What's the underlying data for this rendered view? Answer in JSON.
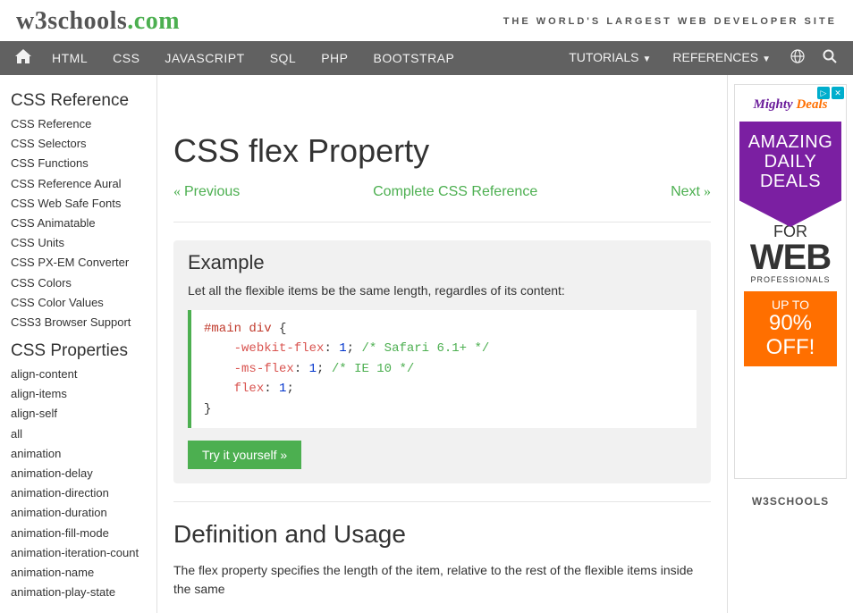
{
  "header": {
    "logo_w3": "w3schools",
    "logo_com": ".com",
    "tagline": "THE WORLD'S LARGEST WEB DEVELOPER SITE"
  },
  "topnav": {
    "items": [
      "HTML",
      "CSS",
      "JAVASCRIPT",
      "SQL",
      "PHP",
      "BOOTSTRAP"
    ],
    "dropdowns": [
      "TUTORIALS",
      "REFERENCES"
    ]
  },
  "sidebar": {
    "section1_title": "CSS Reference",
    "section1_items": [
      "CSS Reference",
      "CSS Selectors",
      "CSS Functions",
      "CSS Reference Aural",
      "CSS Web Safe Fonts",
      "CSS Animatable",
      "CSS Units",
      "CSS PX-EM Converter",
      "CSS Colors",
      "CSS Color Values",
      "CSS3 Browser Support"
    ],
    "section2_title": "CSS Properties",
    "section2_items": [
      "align-content",
      "align-items",
      "align-self",
      "all",
      "animation",
      "animation-delay",
      "animation-direction",
      "animation-duration",
      "animation-fill-mode",
      "animation-iteration-count",
      "animation-name",
      "animation-play-state"
    ]
  },
  "main": {
    "title": "CSS flex Property",
    "prev_label": "Previous",
    "complete_label": "Complete CSS Reference",
    "next_label": "Next",
    "example_title": "Example",
    "example_desc": "Let all the flexible items be the same length, regardles of its content:",
    "code": {
      "selector": "#main div",
      "line1_prop": "-webkit-flex",
      "line1_val": "1",
      "line1_comm": "/* Safari 6.1+ */",
      "line2_prop": "-ms-flex",
      "line2_val": "1",
      "line2_comm": "/* IE 10 */",
      "line3_prop": "flex",
      "line3_val": "1"
    },
    "try_label": "Try it yourself »",
    "defusage_title": "Definition and Usage",
    "defusage_text": "The flex property specifies the length of the item, relative to the rest of the flexible items inside the same"
  },
  "ad": {
    "brand": "Mighty",
    "brand2": "Deals",
    "line1": "AMAZING DAILY DEALS",
    "for": "FOR",
    "web": "WEB",
    "prof": "PROFESSIONALS",
    "upto": "UP TO",
    "pct": "90% OFF!"
  },
  "rightcol": {
    "badge": "W3SCHOOLS"
  }
}
